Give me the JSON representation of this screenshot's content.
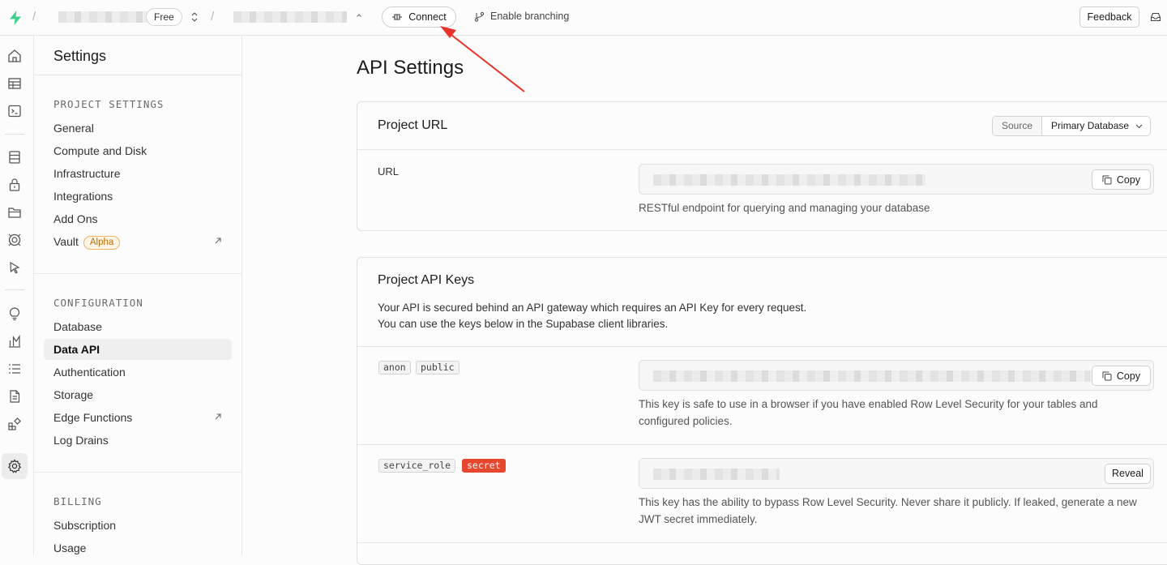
{
  "topbar": {
    "plan_badge": "Free",
    "connect_label": "Connect",
    "branching_label": "Enable branching",
    "feedback_label": "Feedback",
    "accent": "#3ecf8e"
  },
  "sidebar": {
    "title": "Settings",
    "sections": [
      {
        "heading": "PROJECT SETTINGS",
        "items": [
          "General",
          "Compute and Disk",
          "Infrastructure",
          "Integrations",
          "Add Ons",
          "Vault"
        ]
      },
      {
        "heading": "CONFIGURATION",
        "items": [
          "Database",
          "Data API",
          "Authentication",
          "Storage",
          "Edge Functions",
          "Log Drains"
        ]
      },
      {
        "heading": "BILLING",
        "items": [
          "Subscription",
          "Usage"
        ]
      }
    ],
    "vault_badge": "Alpha",
    "active_item": "Data API"
  },
  "rail_icons": [
    "home-icon",
    "table-editor-icon",
    "sql-editor-icon",
    "database-icon",
    "auth-lock-icon",
    "storage-folder-icon",
    "realtime-icon",
    "edge-functions-cursor-icon",
    "advisors-lightbulb-icon",
    "reports-chart-icon",
    "logs-list-icon",
    "api-docs-icon",
    "integrations-icon",
    "settings-gear-icon"
  ],
  "main": {
    "title": "API Settings",
    "project_url": {
      "title": "Project URL",
      "source_label": "Source",
      "source_value": "Primary Database",
      "url_label": "URL",
      "copy_label": "Copy",
      "help": "RESTful endpoint for querying and managing your database"
    },
    "api_keys": {
      "title": "Project API Keys",
      "desc_line1": "Your API is secured behind an API gateway which requires an API Key for every request.",
      "desc_line2": "You can use the keys below in the Supabase client libraries.",
      "anon": {
        "tag1": "anon",
        "tag2": "public",
        "copy_label": "Copy",
        "help": "This key is safe to use in a browser if you have enabled Row Level Security for your tables and configured policies."
      },
      "service": {
        "tag1": "service_role",
        "tag2": "secret",
        "reveal_label": "Reveal",
        "help": "This key has the ability to bypass Row Level Security. Never share it publicly. If leaked, generate a new JWT secret immediately."
      }
    }
  },
  "annotation_color": "#e8332a"
}
